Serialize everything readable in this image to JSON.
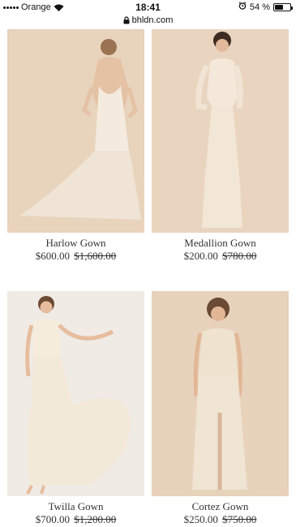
{
  "status_bar": {
    "carrier": "Orange",
    "time": "18:41",
    "battery_percent": "54 %",
    "battery_level": 0.54,
    "alarm_icon": "alarm-clock-icon"
  },
  "browser": {
    "url": "bhldn.com",
    "lock_icon": "lock-icon"
  },
  "products": [
    {
      "name": "Harlow Gown",
      "price": "$600.00",
      "original_price": "$1,600.00"
    },
    {
      "name": "Medallion Gown",
      "price": "$200.00",
      "original_price": "$780.00"
    },
    {
      "name": "Twilla Gown",
      "price": "$700.00",
      "original_price": "$1,200.00"
    },
    {
      "name": "Cortez Gown",
      "price": "$250.00",
      "original_price": "$750.00"
    }
  ],
  "colors": {
    "photo_background": "#e6d2bd",
    "dress": "#f5ece0",
    "price_text": "#333333"
  }
}
